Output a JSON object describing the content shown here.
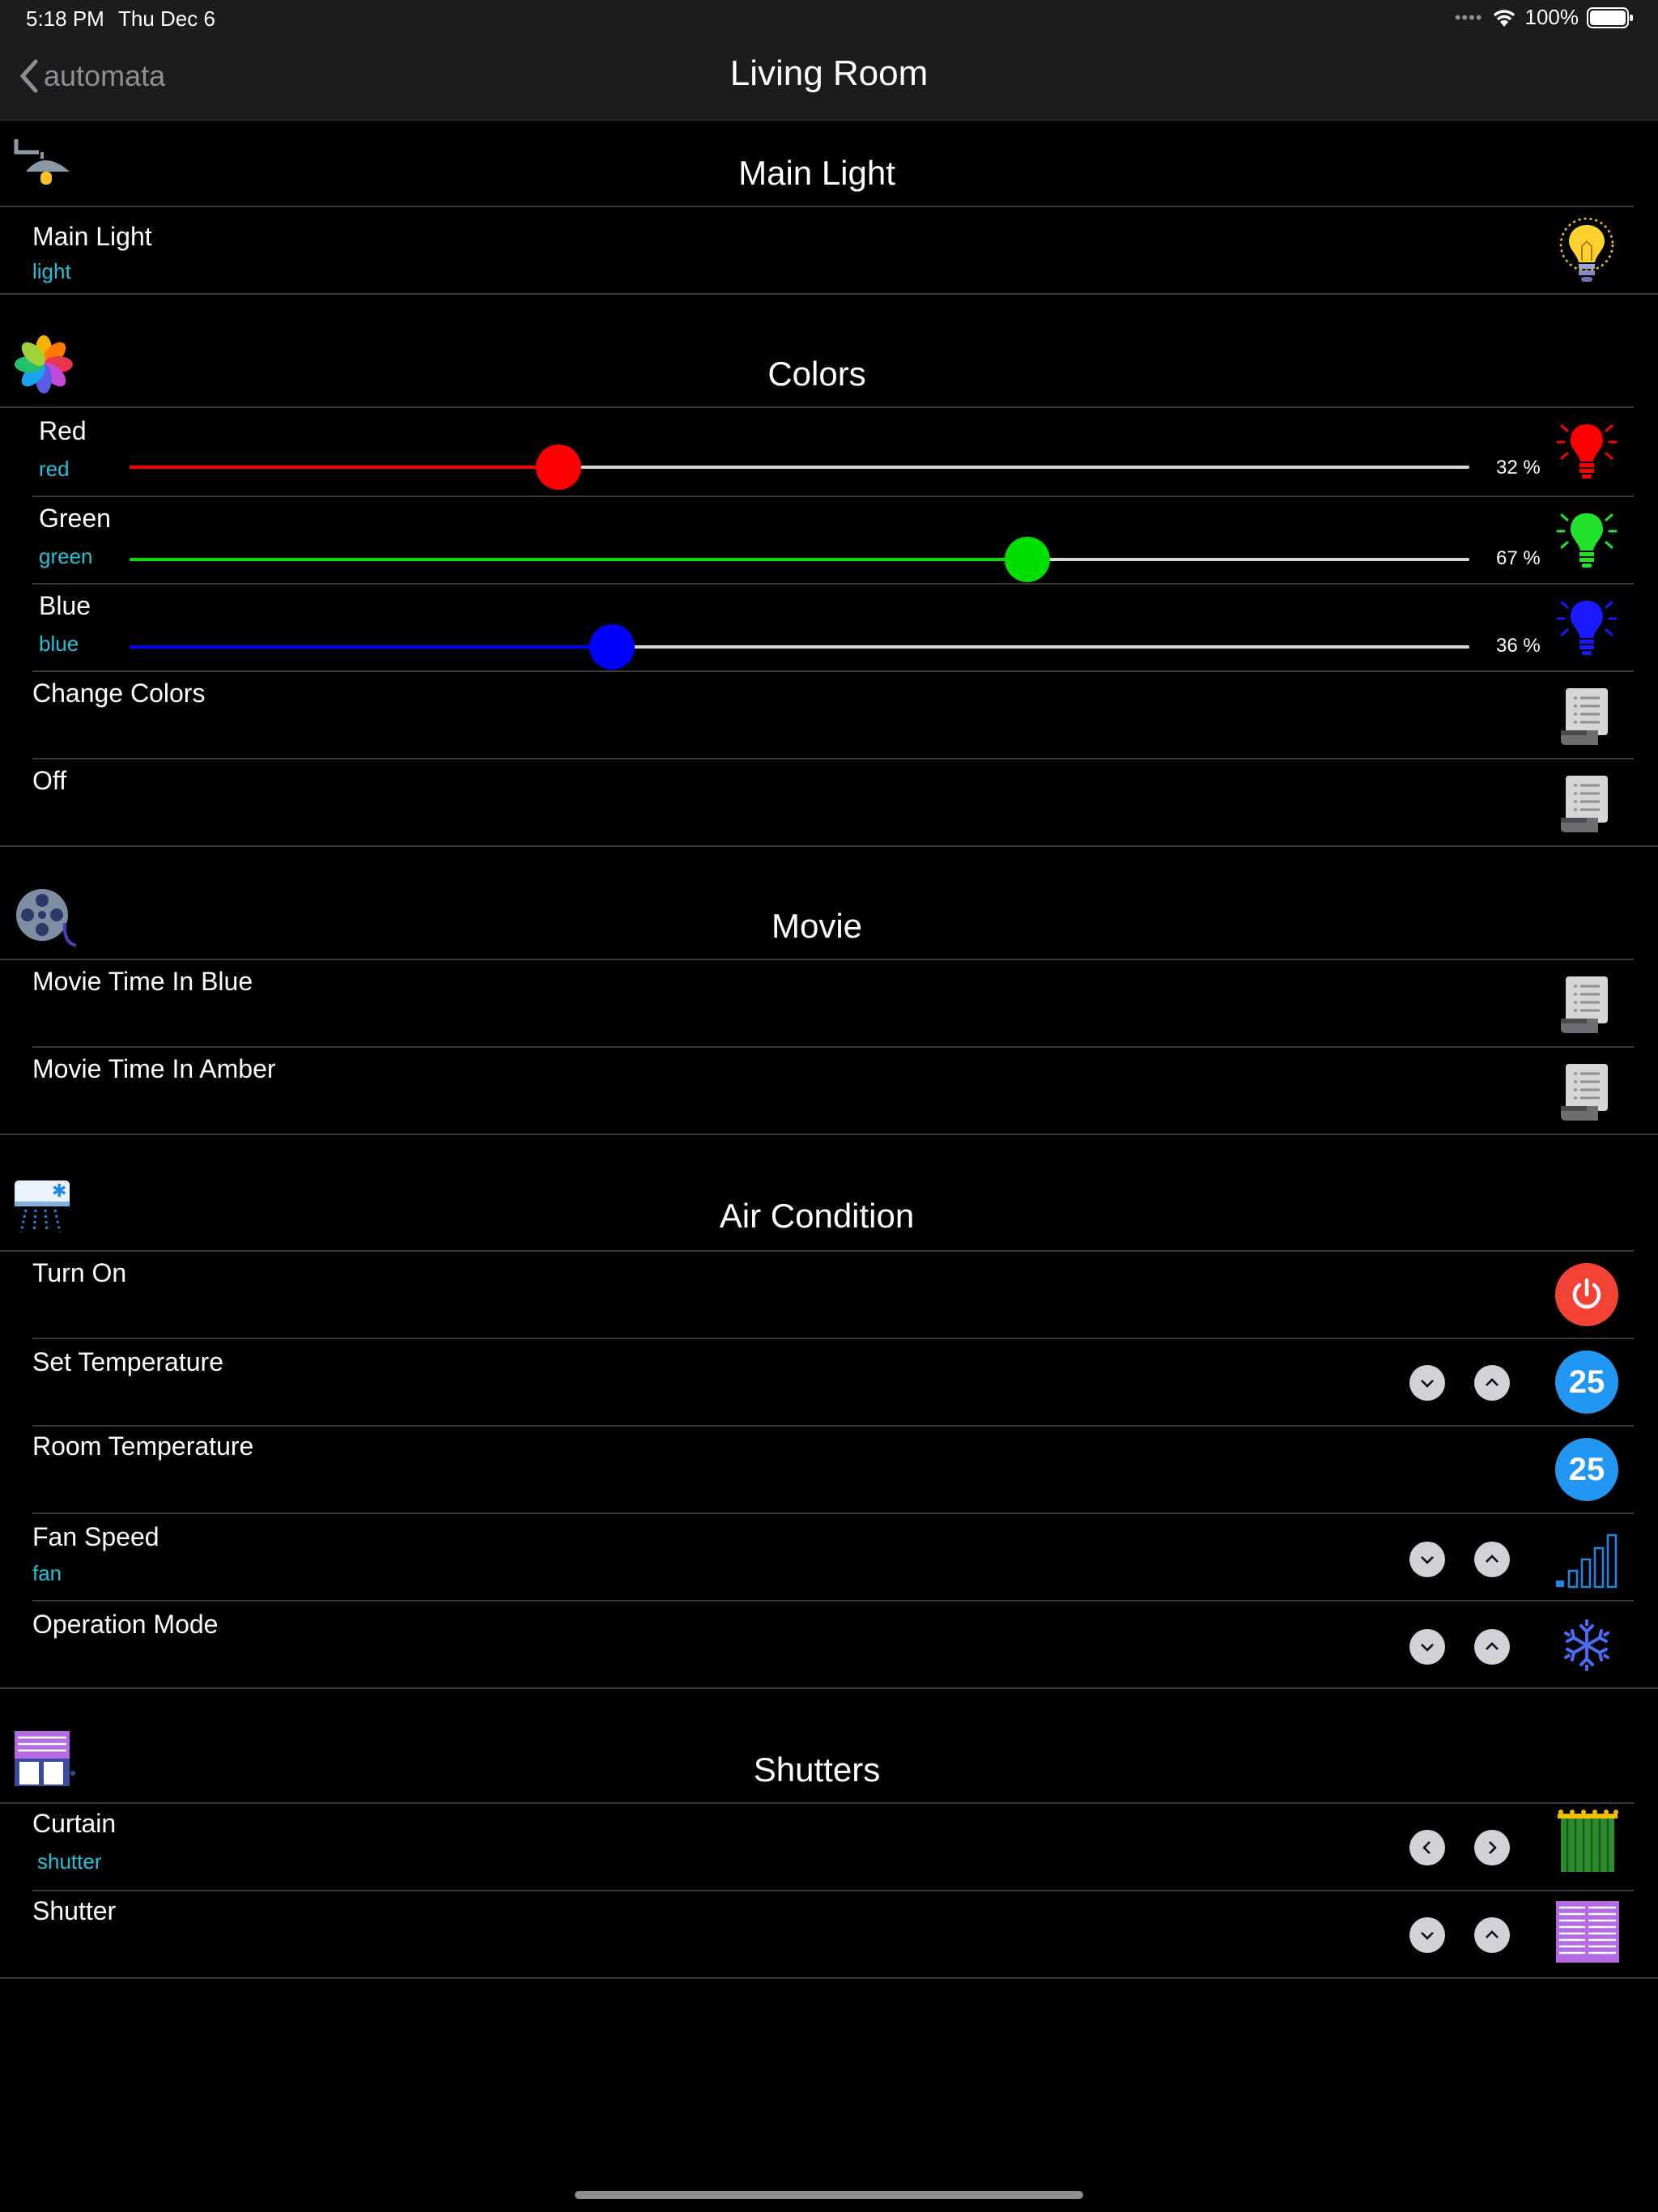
{
  "status": {
    "time": "5:18 PM",
    "date": "Thu Dec 6",
    "battery": "100%"
  },
  "nav": {
    "back_label": "automata",
    "title": "Living Room"
  },
  "sections": {
    "main_light": {
      "title": "Main Light",
      "icon": "ceiling-lamp-icon",
      "rows": [
        {
          "label": "Main Light",
          "sub": "light",
          "icon": "lightbulb-icon"
        }
      ]
    },
    "colors": {
      "title": "Colors",
      "icon": "color-flower-icon",
      "rows": [
        {
          "label": "Red",
          "sub": "red",
          "value": 32,
          "pct": "32 %",
          "color": "#ff0000",
          "icon": "red-bulb-icon"
        },
        {
          "label": "Green",
          "sub": "green",
          "value": 67,
          "pct": "67 %",
          "color": "#00e000",
          "icon": "green-bulb-icon"
        },
        {
          "label": "Blue",
          "sub": "blue",
          "value": 36,
          "pct": "36 %",
          "color": "#0000ff",
          "icon": "blue-bulb-icon"
        },
        {
          "label": "Change Colors",
          "icon": "script-icon"
        },
        {
          "label": "Off",
          "icon": "script-icon"
        }
      ]
    },
    "movie": {
      "title": "Movie",
      "icon": "film-reel-icon",
      "rows": [
        {
          "label": "Movie Time In Blue",
          "icon": "script-icon"
        },
        {
          "label": "Movie Time In Amber",
          "icon": "script-icon"
        }
      ]
    },
    "air": {
      "title": "Air Condition",
      "icon": "air-conditioner-icon",
      "rows": [
        {
          "label": "Turn On",
          "icon": "power-icon"
        },
        {
          "label": "Set Temperature",
          "value": "25"
        },
        {
          "label": "Room Temperature",
          "value": "25"
        },
        {
          "label": "Fan Speed",
          "sub": "fan",
          "icon": "fan-speed-bars-icon"
        },
        {
          "label": "Operation Mode",
          "icon": "snowflake-icon"
        }
      ]
    },
    "shutters": {
      "title": "Shutters",
      "icon": "shutters-icon",
      "rows": [
        {
          "label": "Curtain",
          "sub": "shutter",
          "icon": "curtain-icon"
        },
        {
          "label": "Shutter",
          "icon": "shutter-icon"
        }
      ]
    }
  },
  "colors": {
    "accent": "#22c3d6",
    "badge": "#2196f3",
    "power": "#f44336"
  }
}
